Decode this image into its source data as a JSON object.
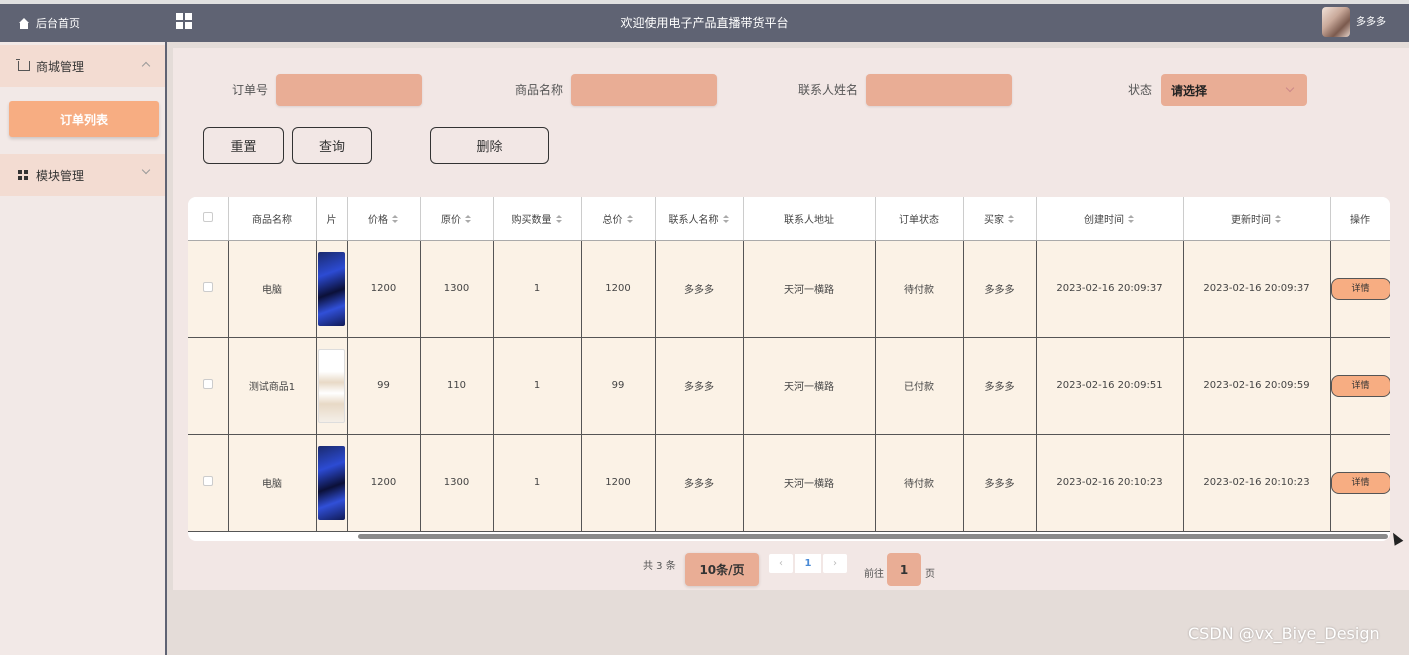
{
  "topbar": {
    "home_label": "后台首页",
    "title": "欢迎使用电子产品直播带货平台",
    "username": "多多多"
  },
  "sidebar": {
    "groups": [
      {
        "label": "商城管理",
        "icon": "cart-icon",
        "expanded": true,
        "items": [
          {
            "label": "订单列表",
            "active": true
          }
        ]
      },
      {
        "label": "模块管理",
        "icon": "module-icon",
        "expanded": false
      }
    ]
  },
  "search": {
    "order_no_label": "订单号",
    "order_no_value": "",
    "product_name_label": "商品名称",
    "product_name_value": "",
    "contact_name_label": "联系人姓名",
    "contact_name_value": "",
    "status_label": "状态",
    "status_value": "请选择"
  },
  "buttons": {
    "reset": "重置",
    "query": "查询",
    "delete": "删除"
  },
  "table": {
    "columns": [
      "商品名称",
      "片",
      "价格",
      "原价",
      "购买数量",
      "总价",
      "联系人名称",
      "联系人地址",
      "订单状态",
      "买家",
      "创建时间",
      "更新时间",
      "操作"
    ],
    "sortable": [
      false,
      false,
      true,
      true,
      true,
      true,
      true,
      false,
      false,
      true,
      true,
      true,
      false
    ],
    "rows": [
      {
        "name": "电脑",
        "thumb": "pc",
        "price": "1200",
        "original": "1300",
        "qty": "1",
        "total": "1200",
        "contact": "多多多",
        "address": "天河一横路",
        "status": "待付款",
        "buyer": "多多多",
        "created": "2023-02-16 20:09:37",
        "updated": "2023-02-16 20:09:37",
        "action": "详情"
      },
      {
        "name": "测试商品1",
        "thumb": "phone",
        "price": "99",
        "original": "110",
        "qty": "1",
        "total": "99",
        "contact": "多多多",
        "address": "天河一横路",
        "status": "已付款",
        "buyer": "多多多",
        "created": "2023-02-16 20:09:51",
        "updated": "2023-02-16 20:09:59",
        "action": "详情"
      },
      {
        "name": "电脑",
        "thumb": "pc",
        "price": "1200",
        "original": "1300",
        "qty": "1",
        "total": "1200",
        "contact": "多多多",
        "address": "天河一横路",
        "status": "待付款",
        "buyer": "多多多",
        "created": "2023-02-16 20:10:23",
        "updated": "2023-02-16 20:10:23",
        "action": "详情"
      }
    ]
  },
  "pagination": {
    "total_text": "共 3 条",
    "page_size": "10条/页",
    "prev": "‹",
    "current_page": "1",
    "next": "›",
    "goto_prefix": "前往",
    "goto_value": "1",
    "goto_suffix": "页"
  },
  "watermark": "CSDN @vx_Biye_Design",
  "colors": {
    "topbar": "#5f6373",
    "accent": "#f7ad82",
    "input_bg": "#e9ad95",
    "row_bg": "#fbf2e6"
  }
}
